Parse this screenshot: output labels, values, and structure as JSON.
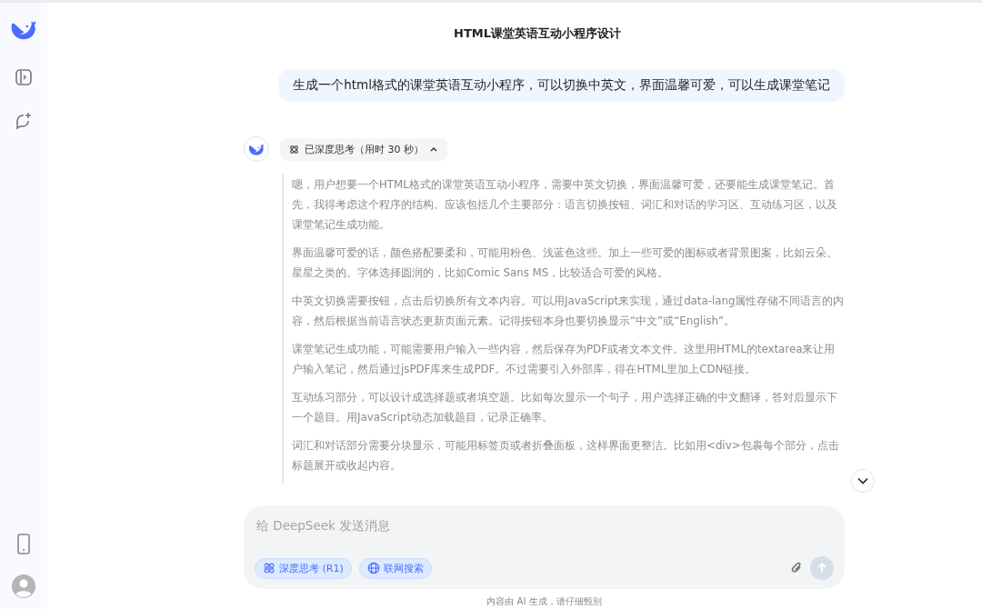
{
  "title": "HTML课堂英语互动小程序设计",
  "user_message": "生成一个html格式的课堂英语互动小程序，可以切换中英文，界面温馨可爱，可以生成课堂笔记",
  "thinking": {
    "label": "已深度思考（用时 30 秒）",
    "expanded": true,
    "paragraphs": [
      "嗯，用户想要一个HTML格式的课堂英语互动小程序，需要中英文切换，界面温馨可爱，还要能生成课堂笔记。首先，我得考虑这个程序的结构。应该包括几个主要部分：语言切换按钮、词汇和对话的学习区、互动练习区，以及课堂笔记生成功能。",
      "界面温馨可爱的话，颜色搭配要柔和，可能用粉色、浅蓝色这些。加上一些可爱的图标或者背景图案，比如云朵、星星之类的。字体选择圆润的，比如Comic Sans MS，比较适合可爱的风格。",
      "中英文切换需要按钮，点击后切换所有文本内容。可以用JavaScript来实现，通过data-lang属性存储不同语言的内容，然后根据当前语言状态更新页面元素。记得按钮本身也要切换显示“中文”或“English”。",
      "课堂笔记生成功能，可能需要用户输入一些内容，然后保存为PDF或者文本文件。这里用HTML的textarea来让用户输入笔记，然后通过jsPDF库来生成PDF。不过需要引入外部库，得在HTML里加上CDN链接。",
      "互动练习部分，可以设计成选择题或者填空题。比如每次显示一个句子，用户选择正确的中文翻译，答对后显示下一个题目。用JavaScript动态加载题目，记录正确率。",
      "词汇和对话部分需要分块显示，可能用标签页或者折叠面板，这样界面更整洁。比如用<div>包裹每个部分，点击标题展开或收起内容。"
    ]
  },
  "composer": {
    "placeholder": "给 DeepSeek 发送消息",
    "toggles": [
      {
        "kind": "think",
        "label": "深度思考 (R1)",
        "selected": true
      },
      {
        "kind": "search",
        "label": "联网搜索",
        "selected": true
      }
    ]
  },
  "footer": "内容由 AI 生成，请仔细甄别"
}
